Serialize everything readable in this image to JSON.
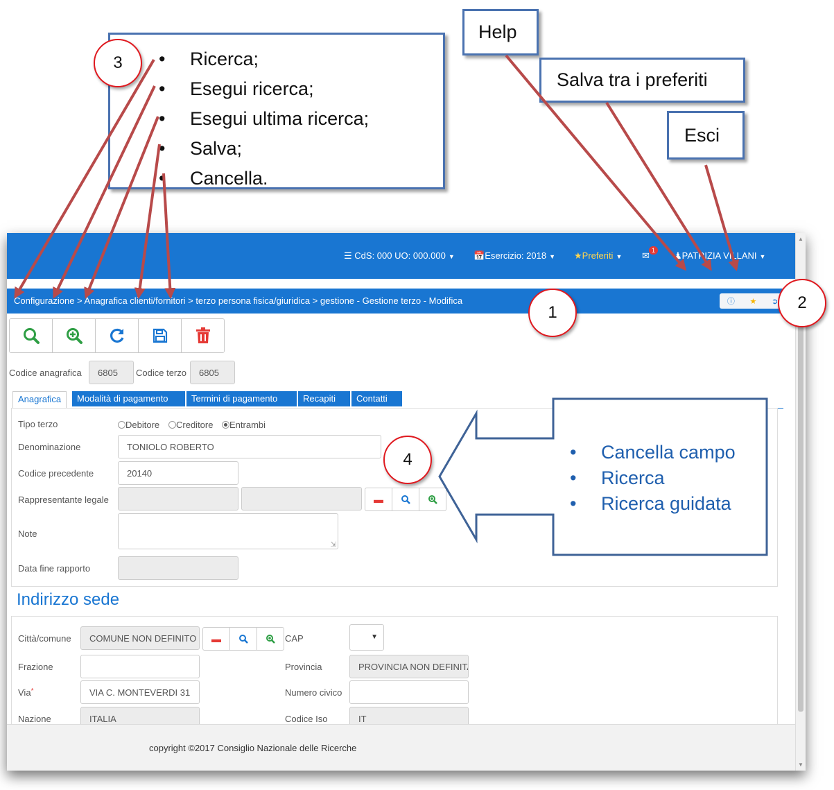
{
  "navbar": {
    "cds": "CdS: 000 UO: 000.000",
    "esercizio": "Esercizio: 2018",
    "preferiti": "Preferiti",
    "mail_count": "1",
    "user": "PATRIZIA VILLANI"
  },
  "breadcrumb": "Configurazione > Anagrafica clienti/fornitori > terzo persona fisica/giuridica > gestione - Gestione terzo - Modifica",
  "codes": {
    "anagrafica_label": "Codice anagrafica",
    "anagrafica_value": "6805",
    "terzo_label": "Codice terzo",
    "terzo_value": "6805"
  },
  "tabs": [
    "Anagrafica",
    "Modalità di pagamento",
    "Termini di pagamento",
    "Recapiti",
    "Contatti"
  ],
  "form": {
    "tipo_terzo_label": "Tipo terzo",
    "tipo_options": [
      "Debitore",
      "Creditore",
      "Entrambi"
    ],
    "tipo_selected": "Entrambi",
    "denominazione_label": "Denominazione",
    "denominazione_value": "TONIOLO ROBERTO",
    "codice_precedente_label": "Codice precedente",
    "codice_precedente_value": "20140",
    "rappresentante_label": "Rappresentante legale",
    "note_label": "Note",
    "data_fine_label": "Data fine rapporto"
  },
  "sede": {
    "title": "Indirizzo sede",
    "citta_label": "Città/comune",
    "citta_value": "COMUNE NON DEFINITO",
    "cap_label": "CAP",
    "frazione_label": "Frazione",
    "provincia_label": "Provincia",
    "provincia_value": "PROVINCIA NON DEFINITA",
    "via_label": "Via",
    "via_required_mark": "*",
    "via_value": "VIA C. MONTEVERDI 31",
    "civico_label": "Numero civico",
    "nazione_label": "Nazione",
    "nazione_value": "ITALIA",
    "iso_label": "Codice Iso",
    "iso_value": "IT"
  },
  "footer": "copyright ©2017 Consiglio Nazionale delle Ricerche",
  "annotations": {
    "toolbar_list": [
      "Ricerca;",
      "Esegui ricerca;",
      "Esegui ultima ricerca;",
      "Salva;",
      "Cancella."
    ],
    "help": "Help",
    "salva_preferiti": "Salva tra i preferiti",
    "esci": "Esci",
    "field_list": [
      "Cancella campo",
      "Ricerca",
      "Ricerca guidata"
    ],
    "numbers": [
      "1",
      "2",
      "3",
      "4"
    ]
  },
  "colors": {
    "primary_blue": "#1976d2",
    "annotation_arrow": "#b84a4a",
    "annotation_circle": "#e0191f",
    "callout_border": "#4a72b0",
    "field_list_text": "#1f5fae"
  }
}
